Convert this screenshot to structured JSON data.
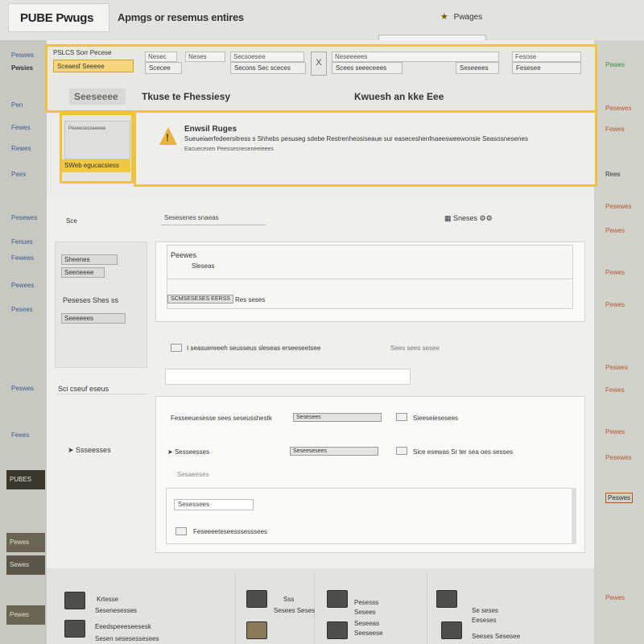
{
  "header": {
    "logo": "PUBE Pwugs",
    "title": "Apmgs or resemus entires",
    "user_label": "Pwages",
    "user_icon": "user-icon"
  },
  "left_rail": {
    "items": [
      "Peswes",
      "Pwsies",
      "Pen",
      "Fewes",
      "Rewes",
      "Pees",
      "Pesewes",
      "Fenues",
      "Fewees",
      "Pewees",
      "Pesees",
      "Peswes",
      "Feees"
    ],
    "thumbs": [
      "PUBES",
      "Pewes",
      "Sewes",
      "Pewes"
    ]
  },
  "right_rail": {
    "items": [
      "Pewes",
      "Pesewes",
      "Fewes",
      "Rees",
      "Pesewes",
      "Pewes",
      "Pewes",
      "Pewes",
      "Peswes",
      "Fewes",
      "Pewes",
      "Pesewes",
      "Peswes",
      "Pewes"
    ]
  },
  "toolbar": {
    "filter_label": "PSLCS Sorr Pecese",
    "filter_select": "Sceaesf Seeeee",
    "fields": [
      "Nesec",
      "Neses",
      "Secsoesee",
      "Neseeeees",
      "Fesose"
    ],
    "buttons": [
      "Scecee",
      "Secons Sec sceces",
      "Scees seeeceees",
      "Seseeees",
      "Fesesee"
    ],
    "x_label": "X",
    "big_buttons": [
      "Seeseeee",
      "Tkuse te Fhessiesy",
      "Kwuesh an kke Eee"
    ]
  },
  "alert": {
    "thumb_text": "Peeeesesseeeee",
    "thumb_caption": "SWeb egucacsiess",
    "title": "Enwsil Ruges",
    "text": "Sueueiaerfedeersitress s Shhebs pesuseg sdebe Restrenheosiseaue sur easeceshenfnaeesweewonsie Seasosnesenes",
    "subtext": "Eacuecesen Peessesneseneeieees"
  },
  "content": {
    "sort_label": "Sce",
    "search_value": "Sesesenes snaeas",
    "view_toggle": "Sneses",
    "left_col": {
      "item1": "Sheenes",
      "item2": "Seeneeee",
      "label": "Peseses Shes ss",
      "select": "Seeeeees",
      "section": "Sci cseuf eseus",
      "link": "Ssseesses"
    },
    "card1": {
      "title": "Peewes",
      "sub": "Sleseas",
      "chip": "SCMSESESES EERSS",
      "chip_tail": "Res seses"
    },
    "row_text": "I seasuereeeh seusseus sleseas erseeseetsee",
    "row_text2": "Sees sees sesee",
    "card2": {
      "row1": "Fesseeuesesse sees seseusshestk",
      "row1_chip": "Sesesees",
      "row1_right": "Sieeseiesesees",
      "row2": "Sesseesses",
      "row2_chip": "Seseesesees",
      "row2_right": "Sice esewas Sr ter sea oes sesses",
      "row3": "Sesaeeses"
    },
    "card3": {
      "field": "Sesessees",
      "row": "Feseeeeteseesssesssees"
    }
  },
  "bottom": {
    "tiles": [
      {
        "title": "Krtesse",
        "sub": "Sesenesesses"
      },
      {
        "title": "Eeedspeeeseesesk",
        "sub": "Sesen sesesessesees"
      },
      {
        "title": "Sss",
        "sub": "Sesees Seses"
      },
      {
        "title": "Pesesss",
        "sub": "Sesees"
      },
      {
        "title": "Seseeas",
        "sub": "Seeseese"
      },
      {
        "title": "Se seses",
        "sub": "Eeseses"
      },
      {
        "title": "Seeses Sesesee",
        "sub": ""
      }
    ]
  },
  "colors": {
    "highlight": "#f0c43a",
    "background": "#ececea",
    "accent_link": "#3c5a8a",
    "warning": "#e8b33a"
  }
}
